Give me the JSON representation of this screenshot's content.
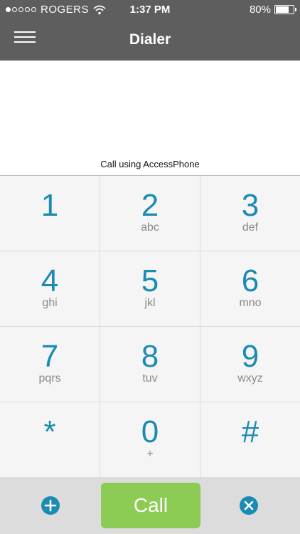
{
  "status_bar": {
    "carrier": "ROGERS",
    "time": "1:37 PM",
    "battery": "80%",
    "battery_level": 0.8,
    "signal_dots_filled": 1,
    "signal_dots_total": 5
  },
  "header": {
    "title": "Dialer"
  },
  "display": {
    "call_using": "Call using AccessPhone"
  },
  "keypad": {
    "keys": [
      {
        "digit": "1",
        "letters": ""
      },
      {
        "digit": "2",
        "letters": "abc"
      },
      {
        "digit": "3",
        "letters": "def"
      },
      {
        "digit": "4",
        "letters": "ghi"
      },
      {
        "digit": "5",
        "letters": "jkl"
      },
      {
        "digit": "6",
        "letters": "mno"
      },
      {
        "digit": "7",
        "letters": "pqrs"
      },
      {
        "digit": "8",
        "letters": "tuv"
      },
      {
        "digit": "9",
        "letters": "wxyz"
      },
      {
        "digit": "*",
        "letters": ""
      },
      {
        "digit": "0",
        "letters": "+"
      },
      {
        "digit": "#",
        "letters": ""
      }
    ]
  },
  "bottom_bar": {
    "call_label": "Call"
  },
  "colors": {
    "header_bg": "#5e5e5e",
    "accent": "#1a8bb3",
    "call_green": "#8ccb54"
  }
}
